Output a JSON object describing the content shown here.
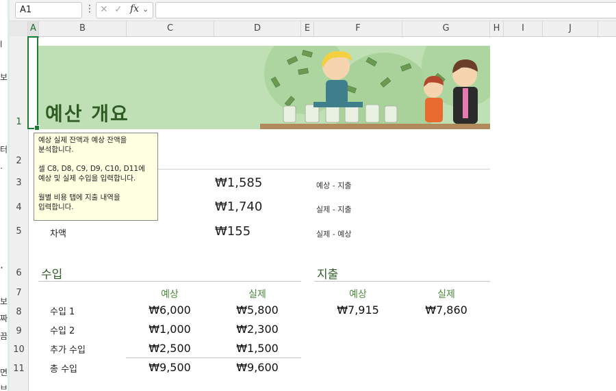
{
  "formula_bar": {
    "name_box": "A1",
    "name_box_dropdown": "⌄",
    "more": "⋮",
    "cancel_icon": "✕",
    "enter_icon": "✓",
    "fx": "fx",
    "fx_dropdown": "⌄",
    "formula": ""
  },
  "columns": [
    "A",
    "B",
    "C",
    "D",
    "E",
    "F",
    "G",
    "H",
    "I",
    "J"
  ],
  "rows": [
    "1",
    "2",
    "3",
    "4",
    "5",
    "6",
    "7",
    "8",
    "9",
    "10",
    "11"
  ],
  "left_edge_chars": [
    "l",
    "보",
    "터",
    ".",
    "·",
    "ㆍ",
    "보",
    "짜",
    "끔",
    "면",
    "브"
  ],
  "banner": {
    "title": "예산 개요",
    "background": "#bfe0b4",
    "title_color": "#2e5c24"
  },
  "tooltip": {
    "line1": "예상 실제 잔액과 예상 잔액을",
    "line2": "분석합니다.",
    "line3": "셀 C8, D8, C9, D9, C10, D11에",
    "line4": "예상 및 실제 수입을 입력합니다.",
    "line5": "월별 비용 탭에 지출 내역을",
    "line6": "입력합니다."
  },
  "summary": [
    {
      "label": "",
      "value": "₩1,585",
      "note": "예상 - 지출"
    },
    {
      "label": "",
      "value": "₩1,740",
      "note": "실제 - 지출"
    },
    {
      "label": "차액",
      "value": "₩155",
      "note": "실제 - 예상"
    }
  ],
  "income": {
    "title": "수입",
    "col_expected": "예상",
    "col_actual": "실제",
    "rows": [
      {
        "label": "수입 1",
        "expected": "₩6,000",
        "actual": "₩5,800"
      },
      {
        "label": "수입 2",
        "expected": "₩1,000",
        "actual": "₩2,300"
      },
      {
        "label": "추가 수입",
        "expected": "₩2,500",
        "actual": "₩1,500"
      },
      {
        "label": "총 수입",
        "expected": "₩9,500",
        "actual": "₩9,600"
      }
    ]
  },
  "expense": {
    "title": "지출",
    "col_expected": "예상",
    "col_actual": "실제",
    "expected": "₩7,915",
    "actual": "₩7,860"
  },
  "colors": {
    "accent": "#1e7b34",
    "heading": "#2e5c24",
    "subheading": "#4c8a3c"
  }
}
